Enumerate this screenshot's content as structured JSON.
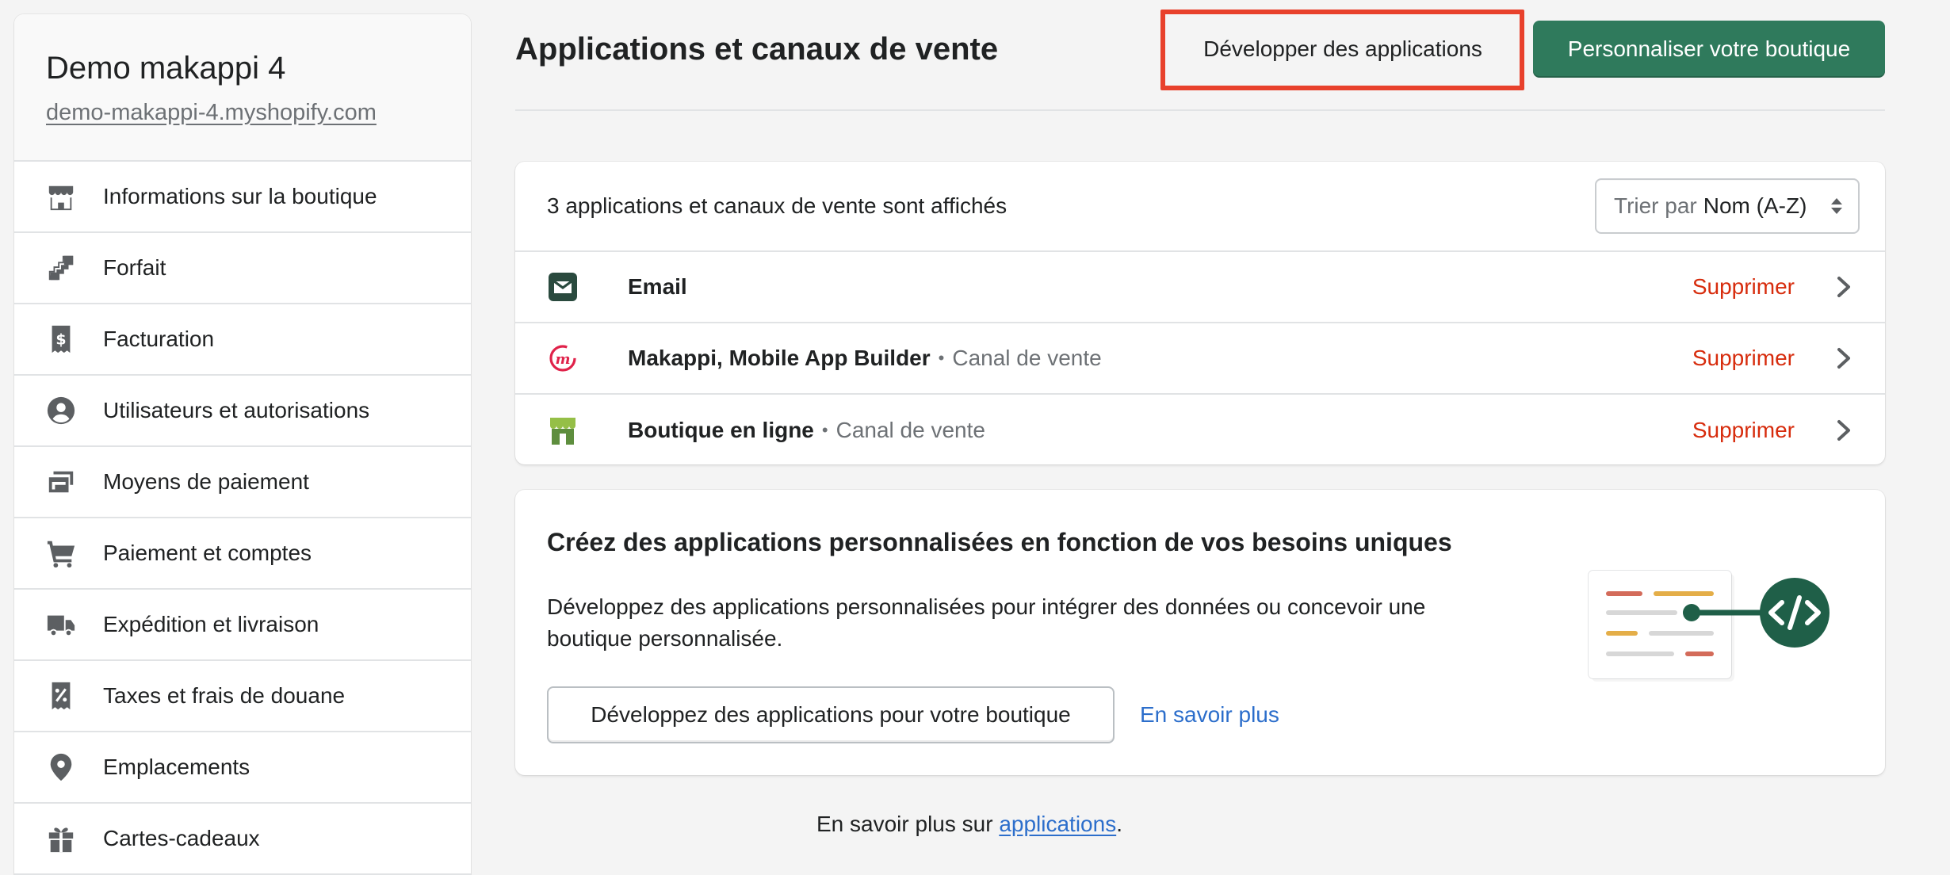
{
  "store": {
    "name": "Demo makappi 4",
    "url": "demo-makappi-4.myshopify.com"
  },
  "sidebar": {
    "items": [
      {
        "label": "Informations sur la boutique",
        "icon": "store-icon"
      },
      {
        "label": "Forfait",
        "icon": "plan-icon"
      },
      {
        "label": "Facturation",
        "icon": "billing-receipt-icon"
      },
      {
        "label": "Utilisateurs et autorisations",
        "icon": "user-circle-icon"
      },
      {
        "label": "Moyens de paiement",
        "icon": "payment-card-icon"
      },
      {
        "label": "Paiement et comptes",
        "icon": "cart-icon"
      },
      {
        "label": "Expédition et livraison",
        "icon": "truck-icon"
      },
      {
        "label": "Taxes et frais de douane",
        "icon": "tax-receipt-icon"
      },
      {
        "label": "Emplacements",
        "icon": "location-pin-icon"
      },
      {
        "label": "Cartes-cadeaux",
        "icon": "gift-icon"
      }
    ]
  },
  "header": {
    "title": "Applications et canaux de vente",
    "develop_button": "Développer des applications",
    "customize_button": "Personnaliser votre boutique"
  },
  "apps": {
    "count_text": "3 applications et canaux de vente sont affichés",
    "sort_prefix": "Trier par",
    "sort_value": "Nom (A-Z)",
    "remove_label": "Supprimer",
    "separator": "•",
    "rows": [
      {
        "name": "Email",
        "type": "",
        "icon": "email-icon"
      },
      {
        "name": "Makappi, Mobile App Builder",
        "type": "Canal de vente",
        "icon": "makappi-logo-icon"
      },
      {
        "name": "Boutique en ligne",
        "type": "Canal de vente",
        "icon": "online-store-icon"
      }
    ]
  },
  "custom": {
    "title": "Créez des applications personnalisées en fonction de vos besoins uniques",
    "description": "Développez des applications personnalisées pour intégrer des données ou concevoir une boutique personnalisée.",
    "button": "Développez des applications pour votre boutique",
    "link": "En savoir plus"
  },
  "footer": {
    "prefix": "En savoir plus sur ",
    "link": "applications",
    "suffix": "."
  },
  "colors": {
    "primary": "#2f7a5c",
    "danger": "#d72c0d",
    "link": "#2c6ecb",
    "highlight": "#e8412c"
  }
}
